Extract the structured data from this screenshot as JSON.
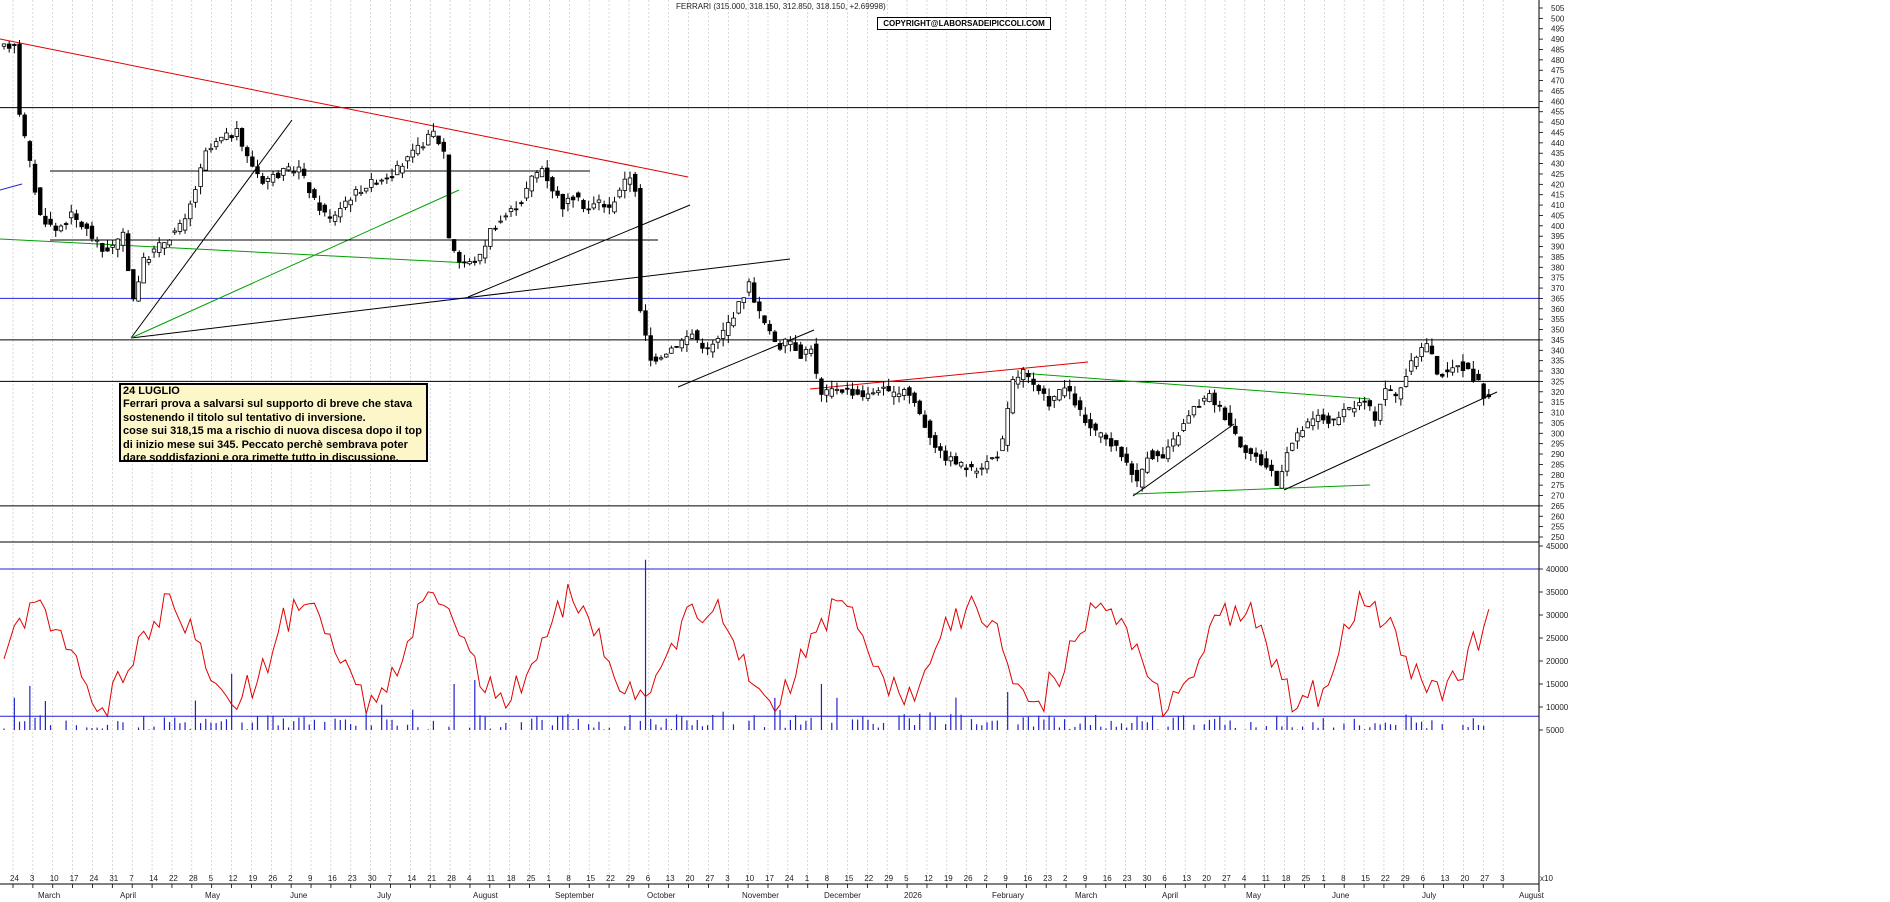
{
  "chart_data": {
    "type": "candlestick",
    "title": "FERRARI (315.000, 318.150, 312.850, 318.150, +2.69998)",
    "copyright": "COPYRIGHT@LABORSADEIPICCOLI.COM",
    "comment": {
      "heading": "24 LUGLIO",
      "lines": [
        "Ferrari prova a salvarsi sul supporto di breve che stava",
        "sostenendo il titolo sul tentativo di inversione.",
        "cose sui 318,15 ma a rischio di nuova discesa dopo il top",
        "di inizio mese sui 345. Peccato perchè sembrava poter",
        "dare soddisfazioni e ora rimette tutto in discussione."
      ]
    },
    "price_axis": {
      "min": 250,
      "max": 505,
      "step": 5,
      "ticks": [
        250,
        255,
        260,
        265,
        270,
        275,
        280,
        285,
        290,
        295,
        300,
        305,
        310,
        315,
        320,
        325,
        330,
        335,
        340,
        345,
        350,
        355,
        360,
        365,
        370,
        375,
        380,
        385,
        390,
        395,
        400,
        405,
        410,
        415,
        420,
        425,
        430,
        435,
        440,
        445,
        450,
        455,
        460,
        465,
        470,
        475,
        480,
        485,
        490,
        495,
        500,
        505
      ]
    },
    "volume_axis": {
      "ticks": [
        5000,
        10000,
        15000,
        20000,
        25000,
        30000,
        35000,
        40000,
        45000
      ],
      "unit_label": "x10"
    },
    "x_axis": {
      "day_labels": [
        "24",
        "3",
        "10",
        "17",
        "24",
        "31",
        "7",
        "14",
        "22",
        "28",
        "5",
        "12",
        "19",
        "26",
        "2",
        "9",
        "16",
        "23",
        "30",
        "7",
        "14",
        "21",
        "28",
        "4",
        "11",
        "18",
        "25",
        "1",
        "8",
        "15",
        "22",
        "29",
        "6",
        "13",
        "20",
        "27",
        "3",
        "10",
        "17",
        "24",
        "1",
        "8",
        "15",
        "22",
        "29",
        "5",
        "12",
        "19",
        "26",
        "2",
        "9",
        "16",
        "23",
        "2",
        "9",
        "16",
        "23",
        "30",
        "6",
        "13",
        "20",
        "27",
        "4",
        "11",
        "18",
        "25",
        "1",
        "8",
        "15",
        "22",
        "29",
        "6",
        "13",
        "20",
        "27",
        "3"
      ],
      "month_labels": [
        "March",
        "April",
        "May",
        "June",
        "July",
        "August",
        "September",
        "October",
        "November",
        "December",
        "2026",
        "February",
        "March",
        "April",
        "May",
        "June",
        "July",
        "August"
      ]
    },
    "horizontal_levels": {
      "black": [
        457,
        345,
        325,
        265
      ],
      "blue": [
        365
      ]
    },
    "volume_levels": {
      "blue": [
        40000,
        8000
      ]
    },
    "price_path_keypoints": [
      [
        0,
        485
      ],
      [
        3,
        488
      ],
      [
        4,
        455
      ],
      [
        6,
        430
      ],
      [
        8,
        405
      ],
      [
        11,
        398
      ],
      [
        14,
        405
      ],
      [
        17,
        398
      ],
      [
        20,
        388
      ],
      [
        22,
        390
      ],
      [
        24,
        395
      ],
      [
        26,
        365
      ],
      [
        28,
        383
      ],
      [
        30,
        388
      ],
      [
        33,
        395
      ],
      [
        36,
        402
      ],
      [
        38,
        418
      ],
      [
        40,
        435
      ],
      [
        43,
        442
      ],
      [
        46,
        445
      ],
      [
        48,
        433
      ],
      [
        51,
        422
      ],
      [
        54,
        425
      ],
      [
        58,
        428
      ],
      [
        61,
        412
      ],
      [
        64,
        403
      ],
      [
        67,
        412
      ],
      [
        70,
        418
      ],
      [
        73,
        422
      ],
      [
        76,
        425
      ],
      [
        79,
        432
      ],
      [
        82,
        440
      ],
      [
        84,
        445
      ],
      [
        86,
        436
      ],
      [
        87,
        395
      ],
      [
        89,
        383
      ],
      [
        91,
        382
      ],
      [
        93,
        385
      ],
      [
        95,
        398
      ],
      [
        98,
        405
      ],
      [
        101,
        412
      ],
      [
        103,
        423
      ],
      [
        105,
        428
      ],
      [
        107,
        418
      ],
      [
        109,
        410
      ],
      [
        111,
        414
      ],
      [
        114,
        408
      ],
      [
        116,
        412
      ],
      [
        118,
        408
      ],
      [
        120,
        418
      ],
      [
        122,
        424
      ],
      [
        123,
        418
      ],
      [
        124,
        358
      ],
      [
        126,
        335
      ],
      [
        128,
        338
      ],
      [
        131,
        343
      ],
      [
        134,
        348
      ],
      [
        137,
        340
      ],
      [
        139,
        345
      ],
      [
        141,
        353
      ],
      [
        143,
        362
      ],
      [
        145,
        372
      ],
      [
        147,
        358
      ],
      [
        149,
        348
      ],
      [
        151,
        342
      ],
      [
        153,
        345
      ],
      [
        155,
        338
      ],
      [
        157,
        342
      ],
      [
        158,
        328
      ],
      [
        159,
        318
      ],
      [
        162,
        322
      ],
      [
        165,
        320
      ],
      [
        168,
        318
      ],
      [
        170,
        322
      ],
      [
        173,
        318
      ],
      [
        175,
        322
      ],
      [
        177,
        315
      ],
      [
        179,
        304
      ],
      [
        182,
        290
      ],
      [
        185,
        286
      ],
      [
        188,
        282
      ],
      [
        191,
        286
      ],
      [
        193,
        290
      ],
      [
        194,
        296
      ],
      [
        196,
        325
      ],
      [
        198,
        330
      ],
      [
        200,
        322
      ],
      [
        203,
        315
      ],
      [
        206,
        322
      ],
      [
        208,
        315
      ],
      [
        210,
        305
      ],
      [
        212,
        300
      ],
      [
        215,
        295
      ],
      [
        217,
        290
      ],
      [
        219,
        282
      ],
      [
        220,
        276
      ],
      [
        222,
        290
      ],
      [
        225,
        288
      ],
      [
        228,
        300
      ],
      [
        231,
        312
      ],
      [
        234,
        318
      ],
      [
        236,
        312
      ],
      [
        238,
        305
      ],
      [
        240,
        295
      ],
      [
        243,
        288
      ],
      [
        246,
        282
      ],
      [
        247,
        275
      ],
      [
        249,
        292
      ],
      [
        252,
        302
      ],
      [
        255,
        308
      ],
      [
        258,
        305
      ],
      [
        261,
        312
      ],
      [
        264,
        315
      ],
      [
        266,
        308
      ],
      [
        268,
        322
      ],
      [
        270,
        318
      ],
      [
        272,
        328
      ],
      [
        274,
        338
      ],
      [
        276,
        344
      ],
      [
        278,
        330
      ],
      [
        280,
        328
      ],
      [
        282,
        334
      ],
      [
        284,
        330
      ],
      [
        286,
        324
      ],
      [
        287,
        318
      ]
    ],
    "candles_count": 288
  }
}
